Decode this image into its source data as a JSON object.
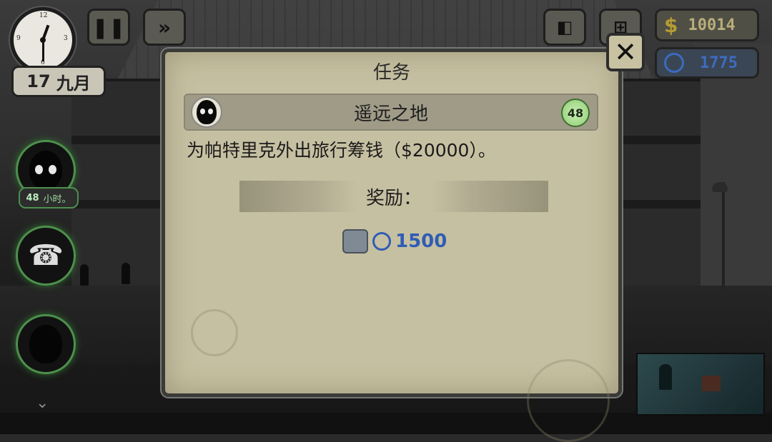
{
  "hud": {
    "clock_label": "clock",
    "date_day": "17",
    "date_month": "九月",
    "money_symbol": "$",
    "money_value": "10014",
    "reputation_value": "1775"
  },
  "sidebar": {
    "hours_value": "48",
    "hours_unit": "小时。"
  },
  "dialog": {
    "title": "任务",
    "close_label": "✕",
    "quest_name": "遥远之地",
    "quest_timer": "48",
    "quest_description": "为帕特里克外出旅行筹钱（$20000）。",
    "reward_label": "奖励：",
    "reward_value": "1500"
  },
  "colors": {
    "dialog_bg": "#c6c0a2",
    "reputation_blue": "#2f5db5",
    "timer_green": "#8fcf73",
    "money_gold": "#b69b34"
  }
}
